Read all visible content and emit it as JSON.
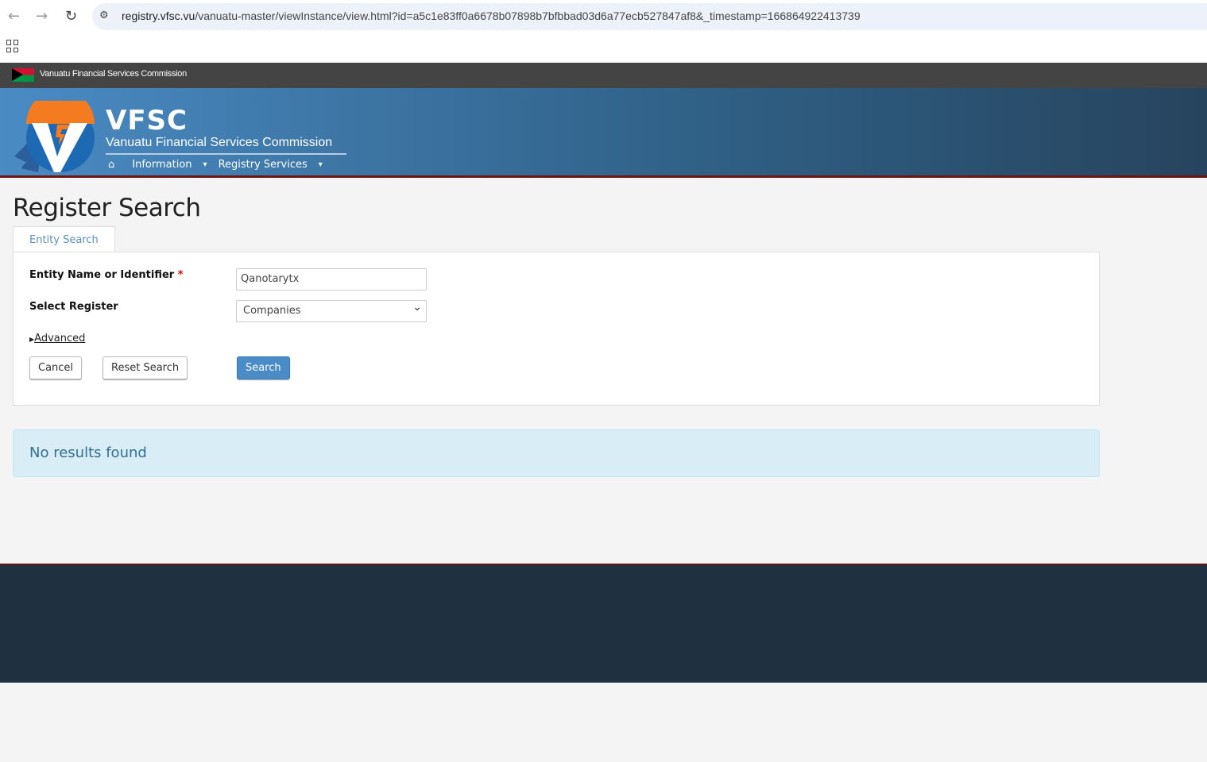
{
  "browser": {
    "url_host": "registry.vfsc.vu",
    "url_rest": "/vanuatu-master/viewInstance/view.html?id=a5c1e83ff0a6678b07898b7bfbbad03d6a77ecb527847af8&_timestamp=166864922413739"
  },
  "topbar": {
    "title": "Vanuatu Financial Services Commission"
  },
  "banner": {
    "abbr": "VFSC",
    "name": "Vanuatu Financial Services Commission",
    "nav": [
      "Information",
      "Registry Services"
    ]
  },
  "page": {
    "title": "Register Search",
    "tab": "Entity Search"
  },
  "form": {
    "name_label": "Entity Name or Identifier",
    "required_mark": "*",
    "name_value": "Qanotarytx",
    "register_label": "Select Register",
    "register_value": "Companies",
    "advanced": "Advanced",
    "cancel": "Cancel",
    "reset": "Reset Search",
    "search": "Search"
  },
  "results": {
    "message": "No results found"
  }
}
